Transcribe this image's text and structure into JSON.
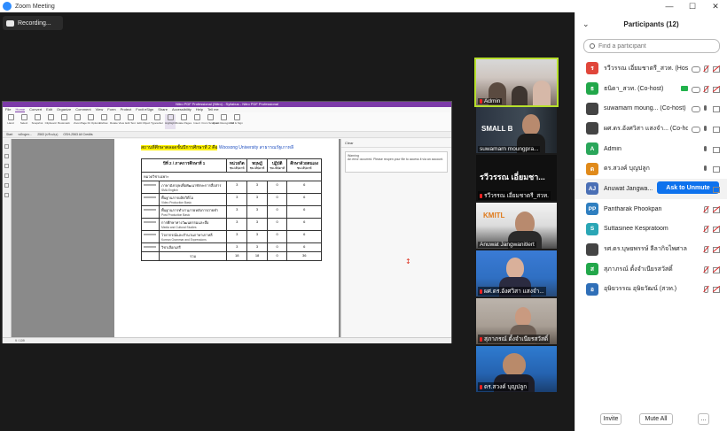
{
  "window": {
    "title": "Zoom Meeting",
    "controls": [
      "—",
      "☐",
      "✕"
    ]
  },
  "recording": {
    "label": "Recording..."
  },
  "shared_screen": {
    "pdf_title": "Nitro PDF Professional (Nitro) - Syllabus - Nitro PDF Professional",
    "menu": [
      "File",
      "Home",
      "Convert",
      "Edit",
      "Organize",
      "Comment",
      "View",
      "Form",
      "Protect",
      "Foxit eSign",
      "Share",
      "Accessibility",
      "Help",
      "Tell me"
    ],
    "active_menu": "Home",
    "ribbon": [
      "Hand",
      "Select",
      "Snapshot",
      "Clipboard",
      "Bookmark",
      "Zoom",
      "Page Fit Options",
      "Reflow",
      "Rotate View",
      "Edit Text",
      "Edit Object",
      "Typewriter",
      "Highlight",
      "Rotate Pages",
      "Insert",
      "From Scanner",
      "Quick Recognition",
      "Fill & Sign"
    ],
    "tabs": [
      "Start",
      "หลักสูตร...",
      "2563 (ปรับปรุง)",
      "OSH-2563 All Credits"
    ],
    "heading_prefix": "สถานที่ศึกษาตลอดชั้นปีการศึกษาที่ 2 คือ",
    "heading_place": "Woosong University สาธารณรัฐเกาหลี",
    "table": {
      "header": [
        "ปีที่ 2 / ภาคการศึกษาที่ 1",
        "หน่วยกิต",
        "ทฤษฎี",
        "ปฏิบัติ",
        "ศึกษาด้วยตนเอง"
      ],
      "header_sub": [
        "",
        "ชม./สัปดาห์",
        "ชม./สัปดาห์",
        "ชม./สัปดาห์",
        "ชม./สัปดาห์"
      ],
      "section": "หมวดวิชาเฉพาะ",
      "rows": [
        {
          "code": "xxxxxxx",
          "th": "ภาษาอังกฤษเพื่อพัฒนาทักษะการสื่อสาร",
          "en": "SMA English",
          "c": "3",
          "t": "3",
          "p": "0",
          "s": "6"
        },
        {
          "code": "xxxxxxx",
          "th": "พื้นฐานการผลิตวิดีโอ",
          "en": "Video Production Basic",
          "c": "3",
          "t": "3",
          "p": "0",
          "s": "6"
        },
        {
          "code": "xxxxxxx",
          "th": "พื้นฐานการทำงานภายหลังการถ่ายทำ",
          "en": "Post Production Basic",
          "c": "3",
          "t": "3",
          "p": "0",
          "s": "6"
        },
        {
          "code": "xxxxxxx",
          "th": "การศึกษาทางวัฒนธรรมและสื่อ",
          "en": "Media and Cultural Studies",
          "c": "3",
          "t": "3",
          "p": "0",
          "s": "6"
        },
        {
          "code": "xxxxxxx",
          "th": "ไวยากรณ์และสำนวนภาษาเกาหลี",
          "en": "Korean Grammar and Expressions",
          "c": "3",
          "t": "3",
          "p": "0",
          "s": "6"
        },
        {
          "code": "xxxxxxx",
          "th": "วิชาเลือกเสรี",
          "en": "",
          "c": "3",
          "t": "3",
          "p": "0",
          "s": "6"
        }
      ],
      "total": {
        "label": "รวม",
        "c": "18",
        "t": "18",
        "p": "0",
        "s": "36"
      }
    },
    "comments": {
      "header": "Clear",
      "warning_title": "Warning",
      "warning_text": "An error occurred. Please reopen your file to access it via an account."
    },
    "status": "9 / 109"
  },
  "videos": [
    {
      "name": "Admin",
      "active": true
    },
    {
      "name": "suwamarn moungpra...",
      "overlay": "SMALL B"
    },
    {
      "name": "รวีวรรณ เอี่ยมชาตรี_สวท.",
      "overlay": "รวีวรรณ เอี่ยมชา..."
    },
    {
      "name": "Anuwat Jangwanitlert",
      "overlay": "KMITL"
    },
    {
      "name": "ผศ.ดร.อังศวิสา แสงจำ..."
    },
    {
      "name": "สุภาภรณ์ ตั้งจำเนียรสวัสดิ์"
    },
    {
      "name": "ดร.สวงค์ บุญปลูก"
    }
  ],
  "participants_panel": {
    "title": "Participants (12)",
    "search_placeholder": "Find a participant",
    "people": [
      {
        "initial": "ร",
        "color": "#e0463a",
        "name": "รวีวรรณ เอี่ยมชาตรี_สวท. (Host, me)",
        "icons": [
          "cloud",
          "mic-off",
          "cam-off"
        ]
      },
      {
        "initial": "ธ",
        "color": "#22a74a",
        "name": "ธนิดา_สวท. (Co-host)",
        "icons": [
          "share-green",
          "cloud",
          "mic-off",
          "cam-off"
        ]
      },
      {
        "initial": "",
        "color": "#444444",
        "name": "suwamarn moung... (Co-host)",
        "icons": [
          "cloud",
          "mic-on",
          "cam-on"
        ]
      },
      {
        "initial": "",
        "color": "#444444",
        "name": "ผศ.ดร.อังศวิสา แสงจำ... (Co-host)",
        "icons": [
          "cloud",
          "mic-on",
          "cam-on"
        ]
      },
      {
        "initial": "A",
        "color": "#2aa65a",
        "name": "Admin",
        "icons": [
          "mic-on",
          "cam-on"
        ]
      },
      {
        "initial": "ด",
        "color": "#e08a1a",
        "name": "ดร.สวงค์ บุญปลูก",
        "icons": [
          "mic-on",
          "cam-on"
        ]
      },
      {
        "initial": "AJ",
        "color": "#4a6fb5",
        "name": "Anuwat Jangwa...",
        "icons": [
          "cam-on"
        ],
        "hover": true,
        "button": "Ask to Unmute"
      },
      {
        "initial": "PP",
        "color": "#2f7fc0",
        "name": "Pantharak Phookpan",
        "icons": [
          "mic-off",
          "cam-off"
        ]
      },
      {
        "initial": "S",
        "color": "#2aa6b5",
        "name": "Suttasinee Kespratoom",
        "icons": [
          "mic-off",
          "cam-off"
        ]
      },
      {
        "initial": "",
        "color": "#444444",
        "name": "รศ.ดร.บุษยพรรษ์ ลีลากิจไพศาล",
        "icons": [
          "mic-off",
          "cam-off"
        ]
      },
      {
        "initial": "ส",
        "color": "#22a74a",
        "name": "สุภาภรณ์ ตั้งจำเนียรสวัสดิ์",
        "icons": [
          "mic-off",
          "cam-off"
        ]
      },
      {
        "initial": "อ",
        "color": "#2f6fb8",
        "name": "อุษิยวรรณ อุษิยวัฒน์ (สวท.)",
        "icons": [
          "mic-off",
          "cam-off"
        ]
      }
    ],
    "footer": {
      "invite": "Invite",
      "mute_all": "Mute All",
      "more": "..."
    }
  }
}
